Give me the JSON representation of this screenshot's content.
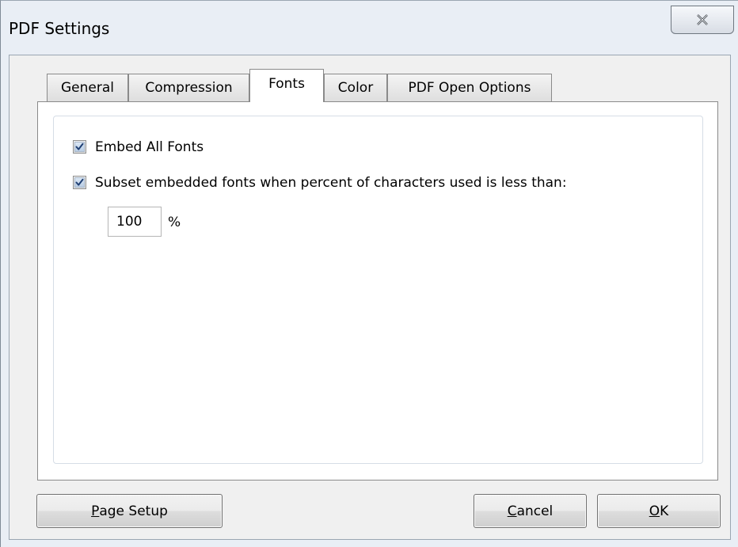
{
  "window": {
    "title": "PDF Settings"
  },
  "tabs": [
    {
      "label": "General",
      "active": false
    },
    {
      "label": "Compression",
      "active": false
    },
    {
      "label": "Fonts",
      "active": true
    },
    {
      "label": "Color",
      "active": false
    },
    {
      "label": "PDF Open Options",
      "active": false
    }
  ],
  "fonts_tab": {
    "embed_all": {
      "label": "Embed All Fonts",
      "checked": true
    },
    "subset": {
      "label": "Subset embedded fonts when percent of characters used is less than:",
      "checked": true
    },
    "percent_value": "100",
    "percent_unit": "%"
  },
  "buttons": {
    "page_setup": {
      "mnemonic": "P",
      "rest": "age Setup"
    },
    "cancel": {
      "mnemonic": "C",
      "rest": "ancel"
    },
    "ok": {
      "mnemonic": "O",
      "rest": "K"
    }
  },
  "icons": {
    "close": "close-icon",
    "check": "checkmark-icon"
  },
  "colors": {
    "checkbox_fill": "#b9cde4",
    "checkmark": "#1f3f73",
    "window_frame": "#e9eef5"
  }
}
